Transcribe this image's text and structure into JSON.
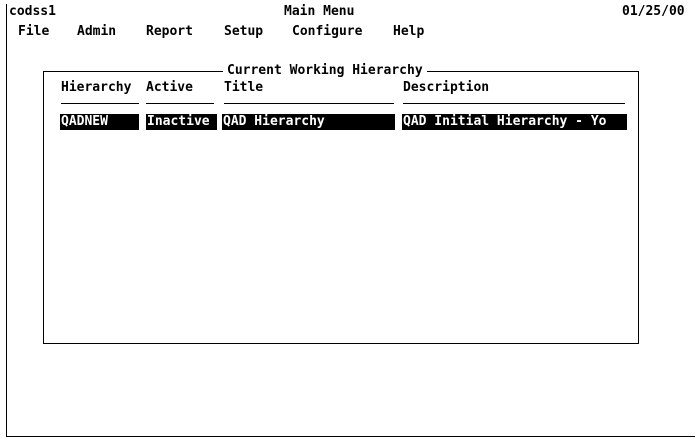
{
  "header": {
    "system_name": "codss1",
    "screen_title": "Main Menu",
    "date": "01/25/00"
  },
  "menu": [
    {
      "label": "File"
    },
    {
      "label": "Admin"
    },
    {
      "label": "Report"
    },
    {
      "label": "Setup"
    },
    {
      "label": "Configure"
    },
    {
      "label": "Help"
    }
  ],
  "panel": {
    "title": "Current Working Hierarchy",
    "columns": [
      "Hierarchy",
      "Active",
      "Title",
      "Description"
    ],
    "rows": [
      [
        "QADNEW",
        "Inactive",
        "QAD Hierarchy",
        "QAD Initial Hierarchy - Yo"
      ]
    ]
  }
}
